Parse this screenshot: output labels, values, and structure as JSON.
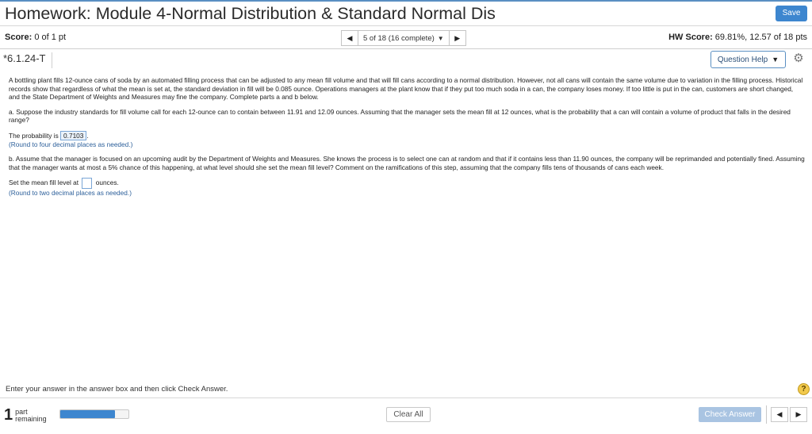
{
  "header": {
    "title": "Homework: Module 4-Normal Distribution & Standard Normal Dis",
    "save_label": "Save"
  },
  "score_bar": {
    "score_label": "Score:",
    "score_value": "0 of 1 pt",
    "question_nav": "5 of 18 (16 complete)",
    "hw_score_label": "HW Score:",
    "hw_score_value": "69.81%, 12.57 of 18 pts"
  },
  "question": {
    "id": "*6.1.24-T",
    "help_label": "Question Help",
    "intro": "A bottling plant fills 12-ounce cans of soda by an automated filling process that can be adjusted to any mean fill volume and that will fill cans according to a normal distribution. However, not all cans will contain the same volume due to variation in the filling process. Historical records show that regardless of what the mean is set at, the standard deviation in fill will be 0.085 ounce. Operations managers at the plant know that if they put too much soda in a can, the company loses money. If too little is put in the can, customers are short changed, and the State Department of Weights and Measures may fine the company. Complete parts a and b below.",
    "part_a": "a. Suppose the industry standards for fill volume call for each 12-ounce can to contain between 11.91 and 12.09 ounces. Assuming that the manager sets the mean fill at 12 ounces, what is the probability that a can will contain a volume of product that falls in the desired range?",
    "answer_a_prefix": "The probability is",
    "answer_a_value": "0.7103",
    "answer_a_suffix": ".",
    "hint_a": "(Round to four decimal places as needed.)",
    "part_b": "b. Assume that the manager is focused on an upcoming audit by the Department of Weights and Measures. She knows the process is to select one can at random and that if it contains less than 11.90 ounces, the company will be reprimanded and potentially fined. Assuming that the manager wants at most a 5% chance of this happening, at what level should she set the mean fill level? Comment on the ramifications of this step, assuming that the company fills tens of thousands of cans each week.",
    "answer_b_prefix": "Set the mean fill level at",
    "answer_b_value": "",
    "answer_b_suffix": "ounces.",
    "hint_b": "(Round to two decimal places as needed.)"
  },
  "footer": {
    "instruction": "Enter your answer in the answer box and then click Check Answer.",
    "help_icon": "?",
    "parts_count": "1",
    "parts_label_1": "part",
    "parts_label_2": "remaining",
    "progress_fraction": 0.8,
    "clear_label": "Clear All",
    "check_label": "Check Answer"
  }
}
